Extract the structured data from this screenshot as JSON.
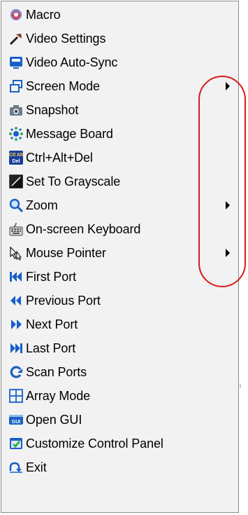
{
  "menu": {
    "items": [
      {
        "label": "Macro",
        "icon": "macro-icon",
        "submenu": false
      },
      {
        "label": "Video Settings",
        "icon": "wrench-icon",
        "submenu": false
      },
      {
        "label": "Video Auto-Sync",
        "icon": "monitor-icon",
        "submenu": false
      },
      {
        "label": "Screen Mode",
        "icon": "screen-mode-icon",
        "submenu": true
      },
      {
        "label": "Snapshot",
        "icon": "camera-icon",
        "submenu": false
      },
      {
        "label": "Message Board",
        "icon": "message-board-icon",
        "submenu": false
      },
      {
        "label": "Ctrl+Alt+Del",
        "icon": "ctrl-alt-del-icon",
        "submenu": false
      },
      {
        "label": "Set To Grayscale",
        "icon": "grayscale-icon",
        "submenu": false
      },
      {
        "label": "Zoom",
        "icon": "magnifier-icon",
        "submenu": true
      },
      {
        "label": "On-screen Keyboard",
        "icon": "keyboard-icon",
        "submenu": false
      },
      {
        "label": "Mouse Pointer",
        "icon": "mouse-pointer-icon",
        "submenu": true
      },
      {
        "label": "First Port",
        "icon": "first-port-icon",
        "submenu": false
      },
      {
        "label": "Previous Port",
        "icon": "previous-port-icon",
        "submenu": false
      },
      {
        "label": "Next Port",
        "icon": "next-port-icon",
        "submenu": false
      },
      {
        "label": "Last Port",
        "icon": "last-port-icon",
        "submenu": false
      },
      {
        "label": "Scan Ports",
        "icon": "scan-icon",
        "submenu": false
      },
      {
        "label": "Array Mode",
        "icon": "grid-icon",
        "submenu": false
      },
      {
        "label": "Open GUI",
        "icon": "gui-icon",
        "submenu": false
      },
      {
        "label": "Customize Control Panel",
        "icon": "control-panel-icon",
        "submenu": false
      },
      {
        "label": "Exit",
        "icon": "exit-icon",
        "submenu": false
      }
    ]
  },
  "colors": {
    "menu_background": "#f2f2f2",
    "highlight_oval": "#d81b1b",
    "icon_blue": "#1a5fc7"
  },
  "icon_glyphs": {
    "ctrl_alt_del_top": "Ctl Alt",
    "ctrl_alt_del_bottom": "Del",
    "gui": "GUI"
  }
}
